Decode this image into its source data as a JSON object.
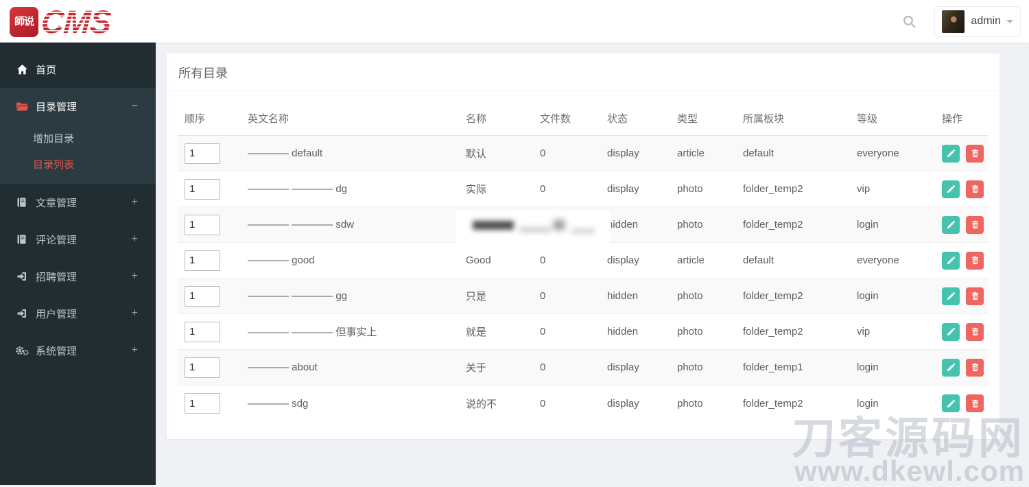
{
  "topbar": {
    "logo": {
      "icon_text": "師说",
      "brand": "CMS"
    },
    "user": {
      "name": "admin"
    }
  },
  "sidebar": {
    "items": [
      {
        "label": "首页",
        "icon": "home"
      },
      {
        "label": "目录管理",
        "icon": "folder-open",
        "toggle": "−",
        "expanded": true,
        "children": [
          {
            "label": "增加目录",
            "active": false
          },
          {
            "label": "目录列表",
            "active": true
          }
        ]
      },
      {
        "label": "文章管理",
        "icon": "book",
        "toggle": "+"
      },
      {
        "label": "评论管理",
        "icon": "book",
        "toggle": "+"
      },
      {
        "label": "招聘管理",
        "icon": "sign-in",
        "toggle": "+"
      },
      {
        "label": "用户管理",
        "icon": "sign-in",
        "toggle": "+"
      },
      {
        "label": "系统管理",
        "icon": "gears",
        "toggle": "+"
      }
    ]
  },
  "main": {
    "card_title": "所有目录",
    "table": {
      "headers": [
        "顺序",
        "英文名称",
        "名称",
        "文件数",
        "状态",
        "类型",
        "所属板块",
        "等级",
        "操作"
      ],
      "rows": [
        {
          "order": "1",
          "en_name": "———— default",
          "name": "默认",
          "files": "0",
          "status": "display",
          "type": "article",
          "board": "default",
          "level": "everyone",
          "censored": false
        },
        {
          "order": "1",
          "en_name": "———— ———— dg",
          "name": "实际",
          "files": "0",
          "status": "display",
          "type": "photo",
          "board": "folder_temp2",
          "level": "vip",
          "censored": false
        },
        {
          "order": "1",
          "en_name": "———— ———— sdw",
          "name": "",
          "files": "",
          "status": "hidden",
          "type": "photo",
          "board": "folder_temp2",
          "level": "login",
          "censored": true
        },
        {
          "order": "1",
          "en_name": "———— good",
          "name": "Good",
          "files": "0",
          "status": "display",
          "type": "article",
          "board": "default",
          "level": "everyone",
          "censored": false
        },
        {
          "order": "1",
          "en_name": "———— ———— gg",
          "name": "只是",
          "files": "0",
          "status": "hidden",
          "type": "photo",
          "board": "folder_temp2",
          "level": "login",
          "censored": false
        },
        {
          "order": "1",
          "en_name": "———— ———— 但事实上",
          "name": "就是",
          "files": "0",
          "status": "hidden",
          "type": "photo",
          "board": "folder_temp2",
          "level": "vip",
          "censored": false
        },
        {
          "order": "1",
          "en_name": "———— about",
          "name": "关于",
          "files": "0",
          "status": "display",
          "type": "photo",
          "board": "folder_temp1",
          "level": "login",
          "censored": false
        },
        {
          "order": "1",
          "en_name": "———— sdg",
          "name": "说的不",
          "files": "0",
          "status": "display",
          "type": "photo",
          "board": "folder_temp2",
          "level": "login",
          "censored": false
        }
      ]
    }
  },
  "watermark": {
    "line1": "刀客源码网",
    "line2": "www.dkewl.com"
  },
  "colors": {
    "brand_red": "#c9232c",
    "sidebar_bg": "#222d32",
    "sidebar_active_bg": "#2c3b41",
    "active_link_red": "#e2574c",
    "edit_button": "#45c3ae",
    "delete_button": "#ef655f"
  }
}
